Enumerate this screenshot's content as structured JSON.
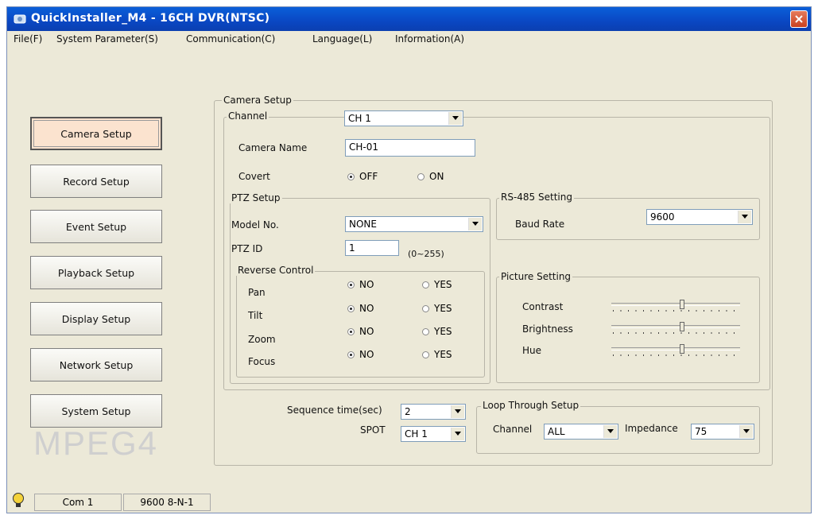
{
  "window": {
    "title": "QuickInstaller_M4 - 16CH DVR(NTSC)"
  },
  "menu": [
    "File(F)",
    "System Parameter(S)",
    "Communication(C)",
    "Language(L)",
    "Information(A)"
  ],
  "sidebar": {
    "buttons": [
      "Camera Setup",
      "Record Setup",
      "Event Setup",
      "Playback Setup",
      "Display Setup",
      "Network Setup",
      "System Setup"
    ],
    "active_index": 0,
    "logo_text": "MPEG4"
  },
  "camera_setup": {
    "group_label": "Camera Setup",
    "channel_label": "Channel",
    "channel_value": "CH 1",
    "camera_name_label": "Camera Name",
    "camera_name_value": "CH-01",
    "covert_label": "Covert",
    "covert_off": "OFF",
    "covert_on": "ON",
    "covert_selected": "OFF"
  },
  "ptz": {
    "group_label": "PTZ Setup",
    "model_label": "Model No.",
    "model_value": "NONE",
    "id_label": "PTZ ID",
    "id_value": "1",
    "id_range": "(0~255)",
    "reverse": {
      "group_label": "Reverse Control",
      "no_label": "NO",
      "yes_label": "YES",
      "rows": [
        {
          "label": "Pan",
          "selected": "NO"
        },
        {
          "label": "Tilt",
          "selected": "NO"
        },
        {
          "label": "Zoom",
          "selected": "NO"
        },
        {
          "label": "Focus",
          "selected": "NO"
        }
      ]
    }
  },
  "rs485": {
    "group_label": "RS-485 Setting",
    "baud_label": "Baud Rate",
    "baud_value": "9600"
  },
  "picture": {
    "group_label": "Picture Setting",
    "rows": [
      {
        "label": "Contrast",
        "level": 0.55
      },
      {
        "label": "Brightness",
        "level": 0.55
      },
      {
        "label": "Hue",
        "level": 0.55
      }
    ]
  },
  "sequence": {
    "label": "Sequence time(sec)",
    "value": "2",
    "spot_label": "SPOT",
    "spot_value": "CH 1"
  },
  "loop": {
    "group_label": "Loop Through Setup",
    "channel_label": "Channel",
    "channel_value": "ALL",
    "impedance_label": "Impedance",
    "impedance_value": "75"
  },
  "status": {
    "port": "Com 1",
    "settings": "9600 8-N-1"
  },
  "colors": {
    "titlebar": "#0a47c3",
    "window_bg": "#ece9d8",
    "active_button": "#fbe3cf",
    "close_button": "#c9411f"
  }
}
